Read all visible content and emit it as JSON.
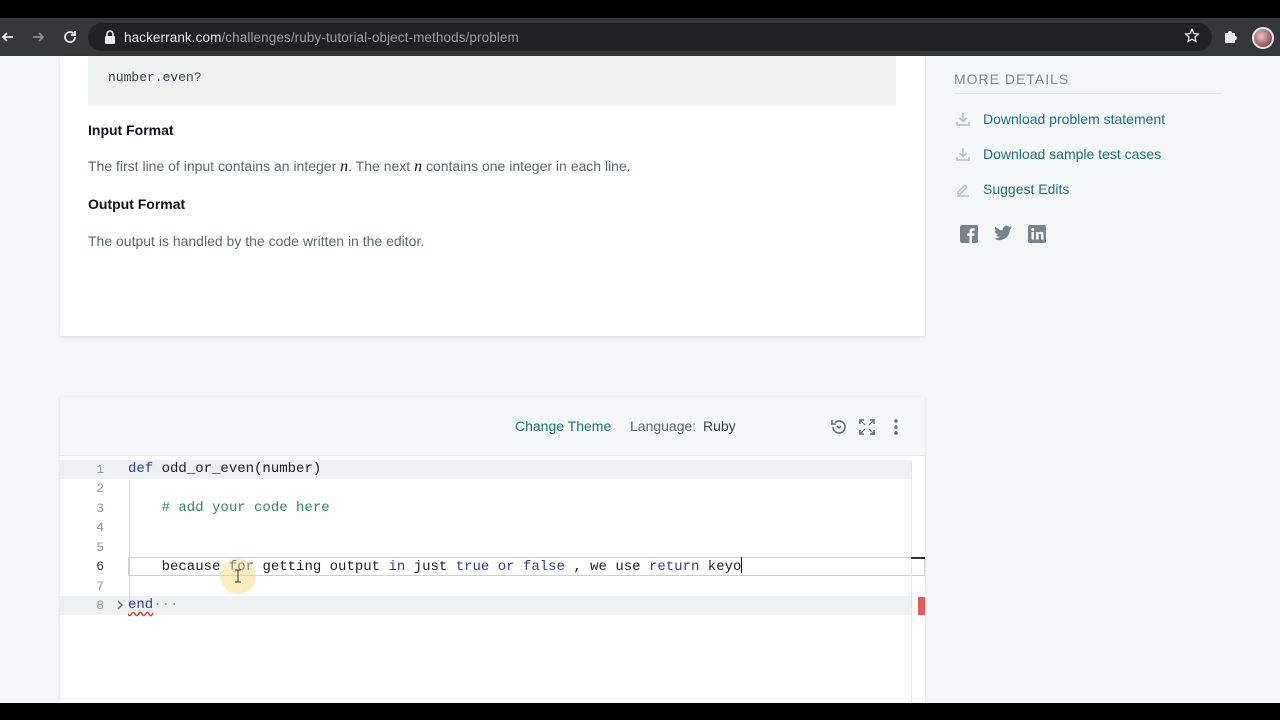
{
  "browser": {
    "url_host": "hackerrank.com",
    "url_path": "/challenges/ruby-tutorial-object-methods/problem"
  },
  "problem": {
    "code_example": "number.even?",
    "input_format_heading": "Input Format",
    "input_format_text_a": "The first line of input contains an integer ",
    "input_format_var_1": "n",
    "input_format_text_b": ". The next ",
    "input_format_var_2": "n",
    "input_format_text_c": " contains one integer in each line.",
    "output_format_heading": "Output Format",
    "output_format_text": "The output is handled by the code written in the editor."
  },
  "sidebar": {
    "title": "MORE DETAILS",
    "links": [
      {
        "label": "Download problem statement",
        "icon": "download-icon"
      },
      {
        "label": "Download sample test cases",
        "icon": "download-icon"
      },
      {
        "label": "Suggest Edits",
        "icon": "pencil-icon"
      }
    ],
    "social": [
      "facebook-icon",
      "twitter-icon",
      "linkedin-icon"
    ]
  },
  "editor": {
    "change_theme": "Change Theme",
    "language_label": "Language:",
    "language_value": "Ruby",
    "line_numbers": [
      "1",
      "2",
      "3",
      "4",
      "5",
      "6",
      "7",
      "8"
    ],
    "code": {
      "l1_kw": "def",
      "l1_rest": " odd_or_even(number)",
      "l3_comment": "    # add your code here",
      "l6_a": "    because ",
      "l6_for": "for",
      "l6_b": " getting output ",
      "l6_in": "in",
      "l6_c": " just ",
      "l6_true": "true",
      "l6_d": " ",
      "l6_or": "or",
      "l6_e": " ",
      "l6_false": "false",
      "l6_f": " , we use ",
      "l6_return": "return",
      "l6_g": " keyo",
      "l8_kw": "end",
      "l8_dots": "···"
    }
  },
  "colors": {
    "link": "#1c6f8a",
    "keyword": "#2e3d9b",
    "comment": "#2e8b57",
    "error": "#e35b5b"
  }
}
